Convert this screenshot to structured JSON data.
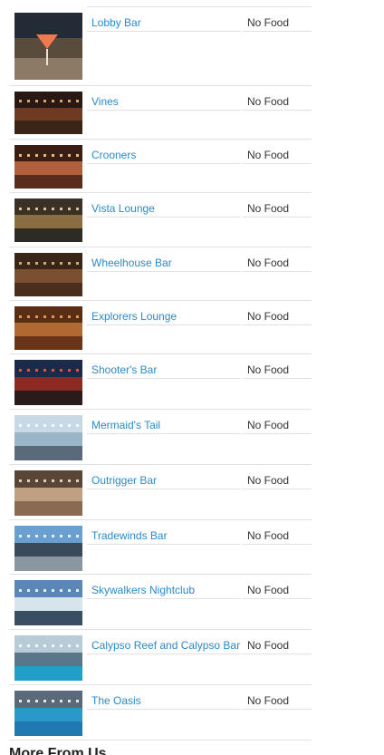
{
  "venues": [
    {
      "name": "Lobby Bar",
      "food": "No Food",
      "colors": [
        "#222b36",
        "#5a4c3c",
        "#8c7a66"
      ],
      "accent": "#f07a50"
    },
    {
      "name": "Vines",
      "food": "No Food",
      "colors": [
        "#2a1812",
        "#6e3a22",
        "#3a2418"
      ],
      "accent": "#f0c078"
    },
    {
      "name": "Crooners",
      "food": "No Food",
      "colors": [
        "#3a1e14",
        "#b0603a",
        "#5a2c1c"
      ],
      "accent": "#ffd890"
    },
    {
      "name": "Vista Lounge",
      "food": "No Food",
      "colors": [
        "#3a3026",
        "#8a6e42",
        "#2e2a24"
      ],
      "accent": "#f4e0a0"
    },
    {
      "name": "Wheelhouse Bar",
      "food": "No Food",
      "colors": [
        "#3a2618",
        "#7a5030",
        "#4a2e1e"
      ],
      "accent": "#e8c488"
    },
    {
      "name": "Explorers Lounge",
      "food": "No Food",
      "colors": [
        "#5a2e14",
        "#b06a30",
        "#6a3418"
      ],
      "accent": "#f0b060"
    },
    {
      "name": "Shooter's Bar",
      "food": "No Food",
      "colors": [
        "#1a2a4a",
        "#8a2a22",
        "#2a1a1a"
      ],
      "accent": "#ff5a3a"
    },
    {
      "name": "Mermaid's Tail",
      "food": "No Food",
      "colors": [
        "#c8d8e4",
        "#9ab4c8",
        "#5a6a7a"
      ],
      "accent": "#ffffff"
    },
    {
      "name": "Outrigger Bar",
      "food": "No Food",
      "colors": [
        "#5a4636",
        "#c0a080",
        "#8a6a50"
      ],
      "accent": "#f8e8d0"
    },
    {
      "name": "Tradewinds Bar",
      "food": "No Food",
      "colors": [
        "#6aa0d0",
        "#3a4a5a",
        "#8a96a0"
      ],
      "accent": "#ffffff"
    },
    {
      "name": "Skywalkers Nightclub",
      "food": "No Food",
      "colors": [
        "#5a86b8",
        "#d8e4ec",
        "#3a4e62"
      ],
      "accent": "#ffffff"
    },
    {
      "name": "Calypso Reef and Calypso Bar",
      "food": "No Food",
      "colors": [
        "#b8ccd8",
        "#5a7688",
        "#1ea0c8"
      ],
      "accent": "#ffffff"
    },
    {
      "name": "The Oasis",
      "food": "No Food",
      "colors": [
        "#5a6a78",
        "#2a98c8",
        "#1e7ab0"
      ],
      "accent": "#ffffff"
    }
  ],
  "more_heading": "More From Us"
}
